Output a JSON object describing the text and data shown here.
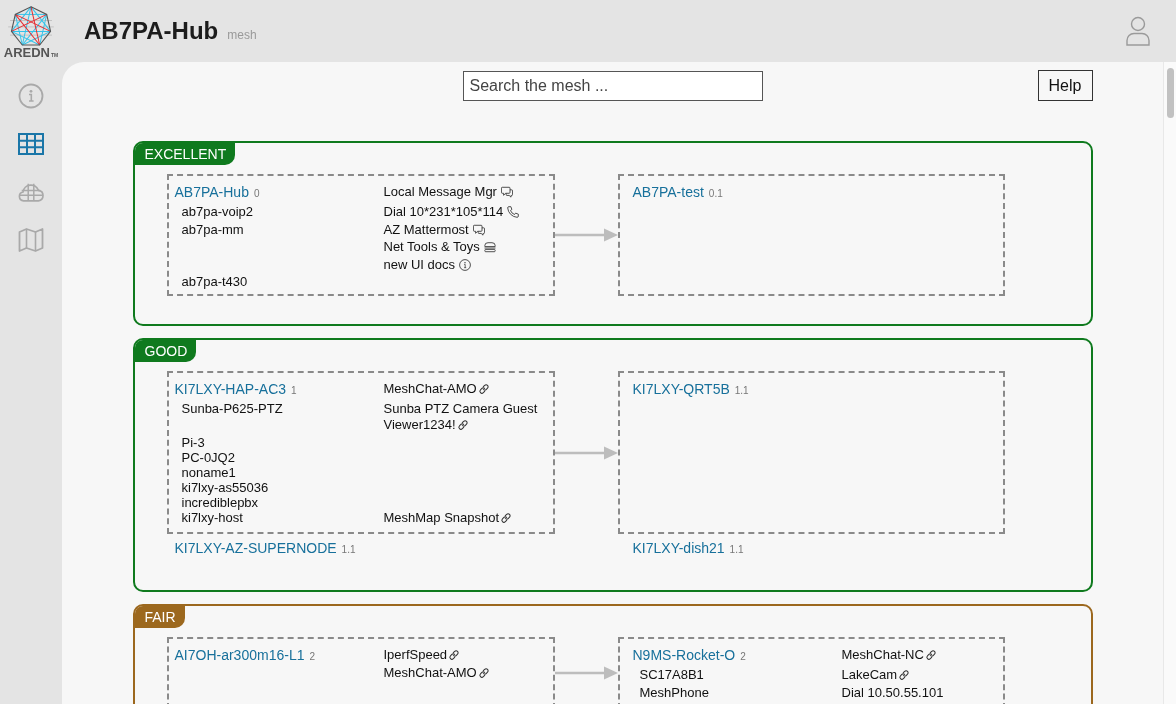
{
  "header": {
    "logo_text": "AREDN$_{TM}$",
    "title": "AB7PA-Hub",
    "subtitle": "mesh"
  },
  "sidebar": {
    "items": [
      {
        "kind": "info",
        "selected": false
      },
      {
        "kind": "grid",
        "selected": true
      },
      {
        "kind": "globe",
        "selected": false
      },
      {
        "kind": "map",
        "selected": false
      }
    ]
  },
  "toolbar": {
    "search": {
      "placeholder": "Search the mesh ..."
    },
    "help_button": "Help"
  },
  "sections": [
    {
      "label": "EXCELLENT",
      "color": "#0f7a1e",
      "rows": [
        {
          "linked": true,
          "nodes": [
            {
              "name": "AB7PA-Hub",
              "hops": "0",
              "framed": true,
              "services": [
                {
                  "name": "Local Message Mgr",
                  "kind": "chat"
                }
              ],
              "hosts": [
                {
                  "name": "ab7pa-voip2",
                  "services": [
                    {
                      "name": "Dial 10*231*105*114",
                      "kind": "phone"
                    }
                  ]
                },
                {
                  "name": "ab7pa-mm",
                  "services": [
                    {
                      "name": "AZ Mattermost",
                      "kind": "chat"
                    },
                    {
                      "name": "Net Tools & Toys",
                      "kind": "stack"
                    },
                    {
                      "name": "new UI docs",
                      "kind": "info"
                    }
                  ]
                },
                {
                  "name": "ab7pa-t430"
                }
              ]
            },
            {
              "name": "AB7PA-test",
              "hops": "0.1",
              "framed": true
            }
          ]
        }
      ]
    },
    {
      "label": "GOOD",
      "color": "#0f7a1e",
      "rows": [
        {
          "linked": true,
          "nodes": [
            {
              "name": "KI7LXY-HAP-AC3",
              "hops": "1",
              "framed": true,
              "services": [
                {
                  "name": "MeshChat-AMO",
                  "kind": "link"
                }
              ],
              "hosts": [
                {
                  "name": "Sunba-P625-PTZ",
                  "services": [
                    {
                      "name": "Sunba PTZ Camera Guest Viewer1234!",
                      "kind": "link"
                    }
                  ]
                },
                {
                  "name": "Pi-3"
                },
                {
                  "name": "PC-0JQ2"
                },
                {
                  "name": "noname1"
                },
                {
                  "name": "ki7lxy-as55036"
                },
                {
                  "name": "incrediblepbx"
                },
                {
                  "name": "ki7lxy-host",
                  "services": [
                    {
                      "name": "MeshMap Snapshot",
                      "kind": "link"
                    }
                  ]
                }
              ]
            },
            {
              "name": "KI7LXY-QRT5B",
              "hops": "1.1",
              "framed": true
            }
          ]
        },
        {
          "linked": false,
          "nodes": [
            {
              "name": "KI7LXY-AZ-SUPERNODE",
              "hops": "1.1",
              "framed": false
            },
            {
              "name": "KI7LXY-dish21",
              "hops": "1.1",
              "framed": false
            }
          ]
        }
      ]
    },
    {
      "label": "FAIR",
      "color": "#9c681e",
      "rows": [
        {
          "linked": true,
          "nodes": [
            {
              "name": "AI7OH-ar300m16-L1",
              "hops": "2",
              "framed": true,
              "services": [
                {
                  "name": "IperfSpeed",
                  "kind": "link"
                },
                {
                  "name": "MeshChat-AMO",
                  "kind": "link"
                }
              ]
            },
            {
              "name": "N9MS-Rocket-O",
              "hops": "2",
              "framed": true,
              "services": [
                {
                  "name": "MeshChat-NC",
                  "kind": "link"
                }
              ],
              "hosts": [
                {
                  "name": "SC17A8B1",
                  "services": [
                    {
                      "name": "LakeCam",
                      "kind": "link"
                    }
                  ]
                },
                {
                  "name": "MeshPhone",
                  "services": [
                    {
                      "name": "Dial 10.50.55.101",
                      "kind": "plain"
                    }
                  ]
                }
              ]
            }
          ]
        }
      ]
    }
  ]
}
